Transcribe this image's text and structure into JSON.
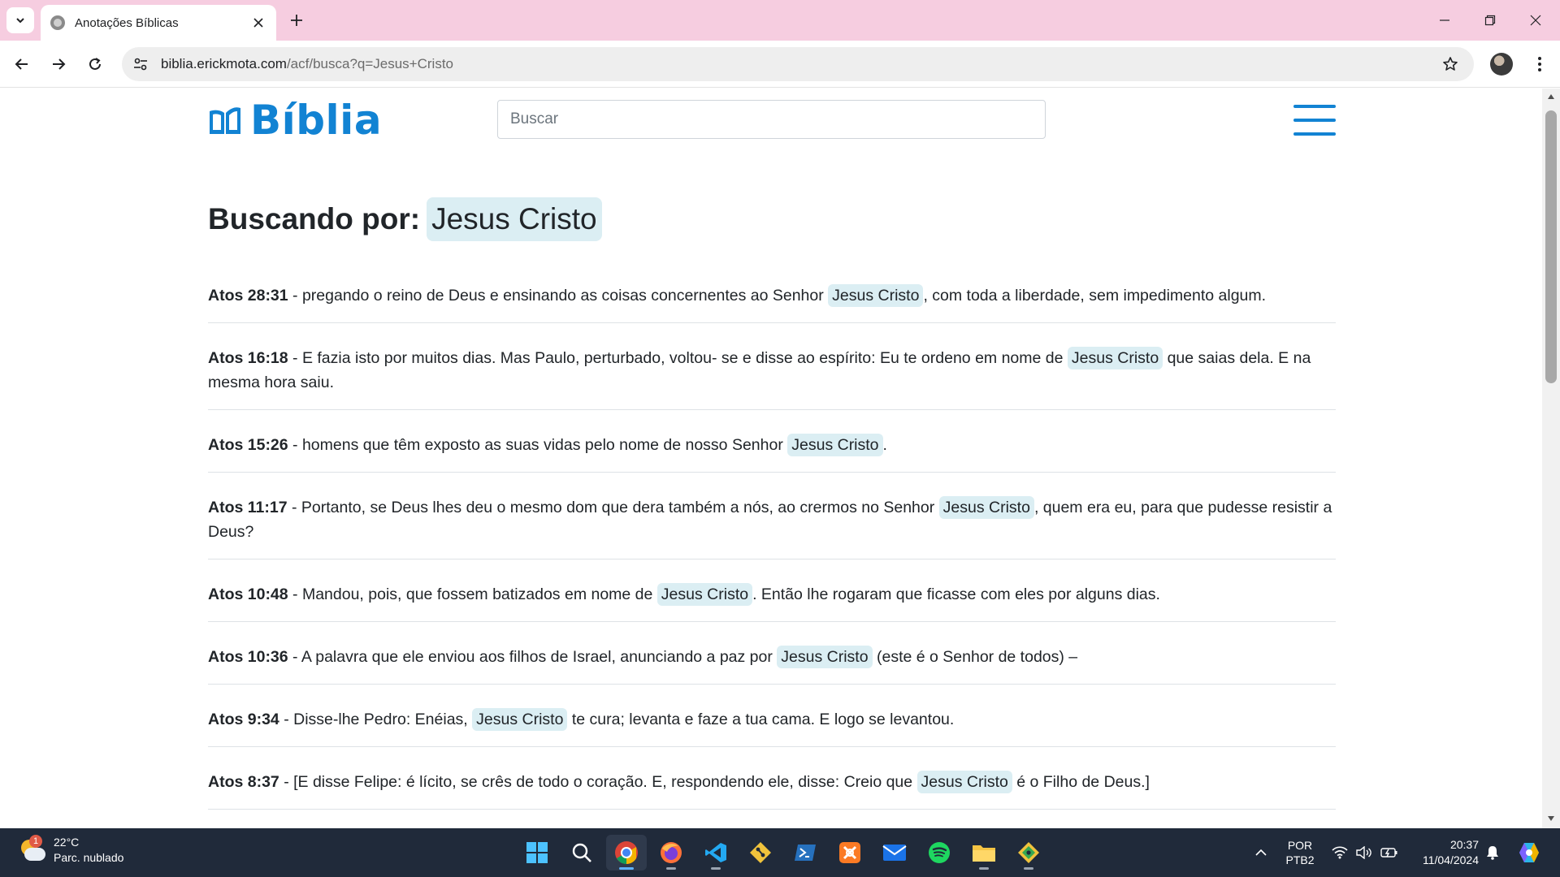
{
  "browser": {
    "tab_title": "Anotações Bíblicas",
    "url_host": "biblia.erickmota.com",
    "url_path": "/acf/busca?q=Jesus+Cristo"
  },
  "site": {
    "logo_text": "Bíblia",
    "search_placeholder": "Buscar"
  },
  "heading": {
    "label": "Buscando por:",
    "query": "Jesus Cristo"
  },
  "results": [
    {
      "ref": "Atos 28:31",
      "before": " - pregando o reino de Deus e ensinando as coisas concernentes ao Senhor ",
      "match": "Jesus Cristo",
      "after": ", com toda a liberdade, sem impedimento algum."
    },
    {
      "ref": "Atos 16:18",
      "before": " - E fazia isto por muitos dias. Mas Paulo, perturbado, voltou- se e disse ao espírito: Eu te ordeno em nome de ",
      "match": "Jesus Cristo",
      "after": " que saias dela. E na mesma hora saiu."
    },
    {
      "ref": "Atos 15:26",
      "before": " - homens que têm exposto as suas vidas pelo nome de nosso Senhor ",
      "match": "Jesus Cristo",
      "after": "."
    },
    {
      "ref": "Atos 11:17",
      "before": " - Portanto, se Deus lhes deu o mesmo dom que dera também a nós, ao crermos no Senhor ",
      "match": "Jesus Cristo",
      "after": ", quem era eu, para que pudesse resistir a Deus?"
    },
    {
      "ref": "Atos 10:48",
      "before": " - Mandou, pois, que fossem batizados em nome de ",
      "match": "Jesus Cristo",
      "after": ". Então lhe rogaram que ficasse com eles por alguns dias."
    },
    {
      "ref": "Atos 10:36",
      "before": " - A palavra que ele enviou aos filhos de Israel, anunciando a paz por ",
      "match": "Jesus Cristo",
      "after": " (este é o Senhor de todos) –"
    },
    {
      "ref": "Atos 9:34",
      "before": " - Disse-lhe Pedro: Enéias, ",
      "match": "Jesus Cristo",
      "after": " te cura; levanta e faze a tua cama. E logo se levantou."
    },
    {
      "ref": "Atos 8:37",
      "before": " - [E disse Felipe: é lícito, se crês de todo o coração. E, respondendo ele, disse: Creio que ",
      "match": "Jesus Cristo",
      "after": " é o Filho de Deus.]"
    }
  ],
  "taskbar": {
    "weather_temp": "22°C",
    "weather_desc": "Parc. nublado",
    "weather_badge": "1",
    "lang_top": "POR",
    "lang_bottom": "PTB2",
    "time": "20:37",
    "date": "11/04/2024",
    "apps": [
      "start-icon",
      "search-icon",
      "chrome-icon",
      "firefox-icon",
      "vscode-icon",
      "git-icon",
      "powershell-icon",
      "xampp-icon",
      "mail-icon",
      "spotify-icon",
      "file-explorer-icon",
      "git-gui-icon"
    ]
  },
  "colors": {
    "brand": "#1283d3",
    "highlight": "#dbeef3",
    "tabbar": "#f6cde0",
    "taskbar": "#202a3a"
  }
}
